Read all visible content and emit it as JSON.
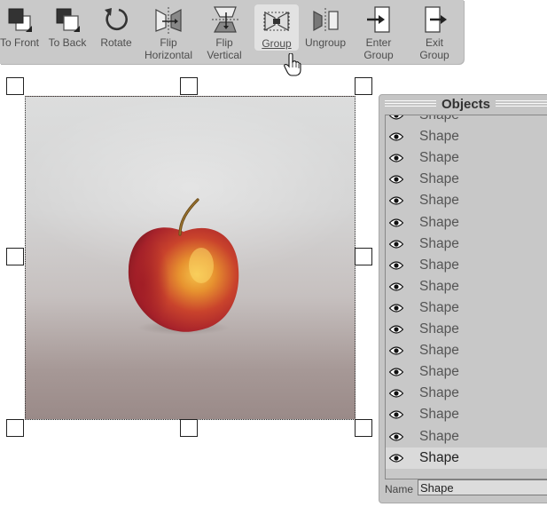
{
  "toolbar": {
    "buttons": [
      {
        "id": "to-front",
        "line1": "To Front",
        "line2": ""
      },
      {
        "id": "to-back",
        "line1": "To Back",
        "line2": ""
      },
      {
        "id": "rotate",
        "line1": "Rotate",
        "line2": ""
      },
      {
        "id": "flip-h",
        "line1": "Flip",
        "line2": "Horizontal"
      },
      {
        "id": "flip-v",
        "line1": "Flip",
        "line2": "Vertical"
      },
      {
        "id": "group",
        "line1": "Group",
        "line2": ""
      },
      {
        "id": "ungroup",
        "line1": "Ungroup",
        "line2": ""
      },
      {
        "id": "enter-group",
        "line1": "Enter",
        "line2": "Group"
      },
      {
        "id": "exit-group",
        "line1": "Exit",
        "line2": "Group"
      }
    ],
    "active": "group"
  },
  "objects_panel": {
    "title": "Objects",
    "rows": [
      "Shape",
      "Shape",
      "Shape",
      "Shape",
      "Shape",
      "Shape",
      "Shape",
      "Shape",
      "Shape",
      "Shape",
      "Shape",
      "Shape",
      "Shape",
      "Shape",
      "Shape",
      "Shape",
      "Shape"
    ],
    "selected_index": 16,
    "name_label": "Name",
    "name_value": "Shape"
  },
  "colors": {
    "toolbar_bg": "#c9c9c9",
    "panel_bg": "#c5c5c5",
    "apple_red": "#b3262b",
    "apple_yellow": "#f0b83a"
  }
}
